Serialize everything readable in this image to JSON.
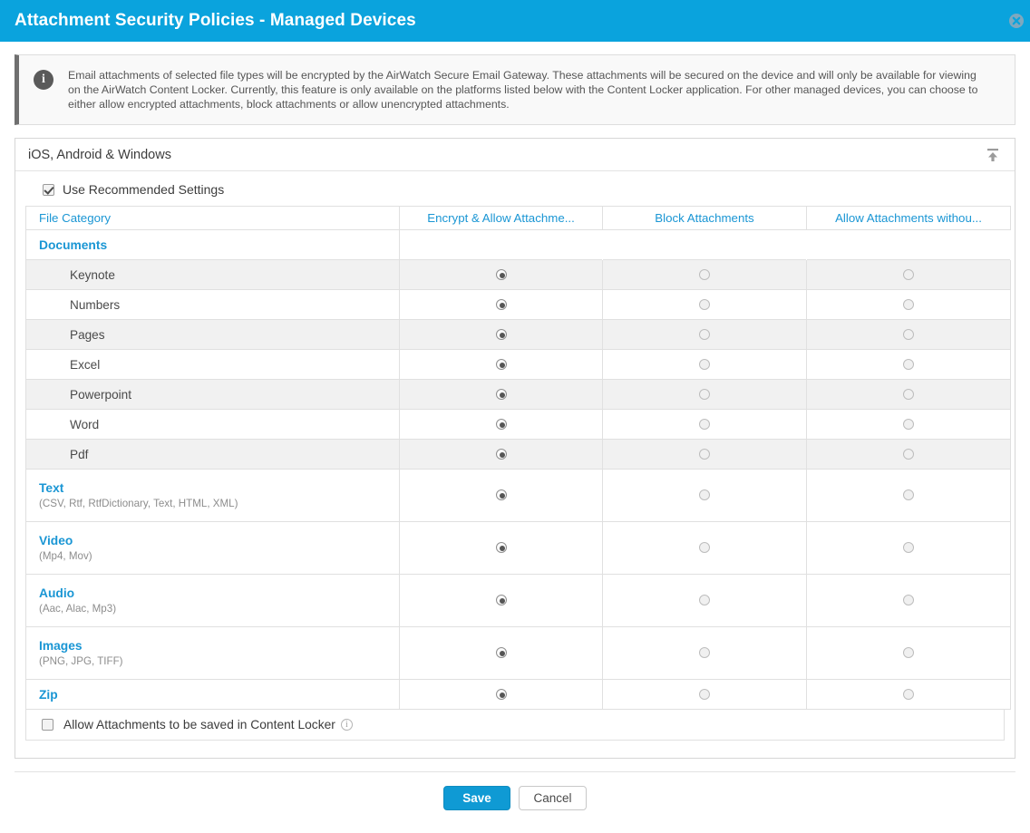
{
  "dialog": {
    "title": "Attachment Security Policies - Managed Devices",
    "close_icon": "close-circle-icon",
    "accent_color": "#0aa3dd"
  },
  "banner": {
    "icon": "info-icon",
    "text": "Email attachments of selected file types will be encrypted by the AirWatch Secure Email Gateway. These attachments will be secured on the device and will only be available for viewing on the AirWatch Content Locker. Currently, this feature is only available on the platforms listed below with the Content Locker application. For other managed devices, you can choose to either allow encrypted attachments, block attachments or allow unencrypted attachments."
  },
  "panel": {
    "header_title": "iOS, Android & Windows",
    "collapse_icon": "collapse-up-icon",
    "recommended": {
      "label": "Use Recommended Settings",
      "checked": true
    },
    "locker": {
      "label": "Allow Attachments to be saved in Content Locker",
      "checked": false,
      "help_icon": "info-circle-icon"
    }
  },
  "table": {
    "headers": [
      "File Category",
      "Encrypt & Allow Attachme...",
      "Block Attachments",
      "Allow Attachments withou..."
    ],
    "rows": [
      {
        "label": "Documents",
        "sub": "",
        "type": "group-head",
        "selected": -1,
        "shade": false
      },
      {
        "label": "Keynote",
        "sub": "",
        "type": "child",
        "selected": 0,
        "shade": true
      },
      {
        "label": "Numbers",
        "sub": "",
        "type": "child",
        "selected": 0,
        "shade": false
      },
      {
        "label": "Pages",
        "sub": "",
        "type": "child",
        "selected": 0,
        "shade": true
      },
      {
        "label": "Excel",
        "sub": "",
        "type": "child",
        "selected": 0,
        "shade": false
      },
      {
        "label": "Powerpoint",
        "sub": "",
        "type": "child",
        "selected": 0,
        "shade": true
      },
      {
        "label": "Word",
        "sub": "",
        "type": "child",
        "selected": 0,
        "shade": false
      },
      {
        "label": "Pdf",
        "sub": "",
        "type": "child",
        "selected": 0,
        "shade": true
      },
      {
        "label": "Text",
        "sub": "(CSV, Rtf, RtfDictionary, Text, HTML, XML)",
        "type": "group",
        "selected": 0,
        "shade": false
      },
      {
        "label": "Video",
        "sub": "(Mp4, Mov)",
        "type": "group",
        "selected": 0,
        "shade": false
      },
      {
        "label": "Audio",
        "sub": "(Aac, Alac, Mp3)",
        "type": "group",
        "selected": 0,
        "shade": false
      },
      {
        "label": "Images",
        "sub": "(PNG, JPG, TIFF)",
        "type": "group",
        "selected": 0,
        "shade": false
      },
      {
        "label": "Zip",
        "sub": "",
        "type": "group",
        "selected": 0,
        "shade": false
      }
    ]
  },
  "footer": {
    "save_label": "Save",
    "cancel_label": "Cancel"
  }
}
